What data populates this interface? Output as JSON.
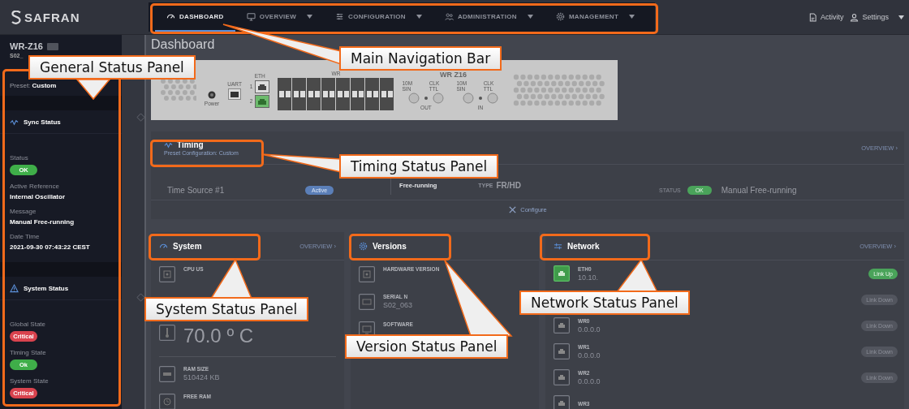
{
  "brand": {
    "name": "SAFRAN"
  },
  "nav": {
    "tabs": [
      {
        "label": "DASHBOARD",
        "selected": true,
        "dropdown": false
      },
      {
        "label": "OVERVIEW",
        "selected": false,
        "dropdown": true
      },
      {
        "label": "CONFIGURATION",
        "selected": false,
        "dropdown": true
      },
      {
        "label": "ADMINISTRATION",
        "selected": false,
        "dropdown": true
      },
      {
        "label": "MANAGEMENT",
        "selected": false,
        "dropdown": true
      }
    ]
  },
  "top_actions": [
    {
      "label": "Activity",
      "kind": "document",
      "dropdown": false
    },
    {
      "label": "Settings",
      "kind": "user",
      "dropdown": true
    }
  ],
  "sidebar": {
    "device": "WR-Z16",
    "device_sub": "S02_",
    "preset": "Preset: **Custom**",
    "sections": [
      {
        "title": "Sync Status",
        "kind": "sync",
        "fields": [
          {
            "label": "Status",
            "badge": "OK",
            "color": "#3fae49"
          },
          {
            "label": "Active Reference",
            "value": "Internal Oscillator"
          },
          {
            "label": "Message",
            "value": "Manual Free-running"
          },
          {
            "label": "Date Time",
            "value": "2021-09-30 07:43:22 CEST"
          }
        ]
      },
      {
        "title": "System Status",
        "kind": "warning",
        "fields": [
          {
            "label": "Global State",
            "badge": "Critical",
            "color": "#d9434e"
          },
          {
            "label": "Timing State",
            "badge": "Ok",
            "color": "#3fae49"
          },
          {
            "label": "System State",
            "badge": "Critical",
            "color": "#d9434e"
          }
        ]
      }
    ]
  },
  "page_title": "Dashboard",
  "device": {
    "power": "Power",
    "uart": "UART",
    "eth": "ETH",
    "eth_ports": [
      {
        "label": "1",
        "active": false
      },
      {
        "label": "2",
        "active": true
      }
    ],
    "wr": "WR",
    "model": "WR Z16",
    "connector_groups": [
      {
        "label": "OUT",
        "connectors": [
          "10M SIN",
          "CLK TTL"
        ]
      },
      {
        "label": "IN",
        "connectors": [
          "10M SIN",
          "CLK TTL"
        ]
      }
    ]
  },
  "timing": {
    "title": "Timing",
    "subtitle": "Preset Configuration: Custom",
    "overview": "OVERVIEW ›",
    "sources": [
      {
        "name": "Time Source #1",
        "badge": "Active",
        "mode": "Free-running",
        "type_label": "TYPE",
        "type": "FR/HD",
        "status_label": "STATUS",
        "status": "OK",
        "message": "Manual Free-running"
      }
    ],
    "configure": "Configure"
  },
  "system": {
    "title": "System",
    "overview": "OVERVIEW ›",
    "items": [
      {
        "kind": "cpu",
        "label": "CPU US"
      },
      {
        "kind": "temperature",
        "value": "70.0 º C"
      },
      {
        "kind": "ram",
        "label": "RAM SIZE",
        "value": "510424 KB"
      },
      {
        "kind": "clock",
        "label": "FREE RAM"
      }
    ]
  },
  "versions": {
    "title": "Versions",
    "items": [
      {
        "kind": "chip",
        "label": "HARDWARE VERSION"
      },
      {
        "kind": "board",
        "label": "SERIAL N",
        "value": "S02_063"
      },
      {
        "kind": "monitor",
        "label": "SOFTWARE"
      }
    ]
  },
  "network": {
    "title": "Network",
    "overview": "OVERVIEW ›",
    "interfaces": [
      {
        "name": "ETH0",
        "address": "10.10.",
        "up": true,
        "status": "Link Up"
      },
      {
        "up": false,
        "status": "Link Down"
      },
      {
        "name": "WR0",
        "address": "0.0.0.0",
        "up": false,
        "status": "Link Down"
      },
      {
        "name": "WR1",
        "address": "0.0.0.0",
        "up": false,
        "status": "Link Down"
      },
      {
        "name": "WR2",
        "address": "0.0.0.0",
        "up": false,
        "status": "Link Down"
      },
      {
        "name": "WR3",
        "up": false
      }
    ]
  },
  "annotations": [
    {
      "text": "General Status Panel"
    },
    {
      "text": "Main Navigation Bar"
    },
    {
      "text": "Timing Status Panel"
    },
    {
      "text": "System Status Panel"
    },
    {
      "text": "Version Status Panel"
    },
    {
      "text": "Network Status Panel"
    }
  ]
}
